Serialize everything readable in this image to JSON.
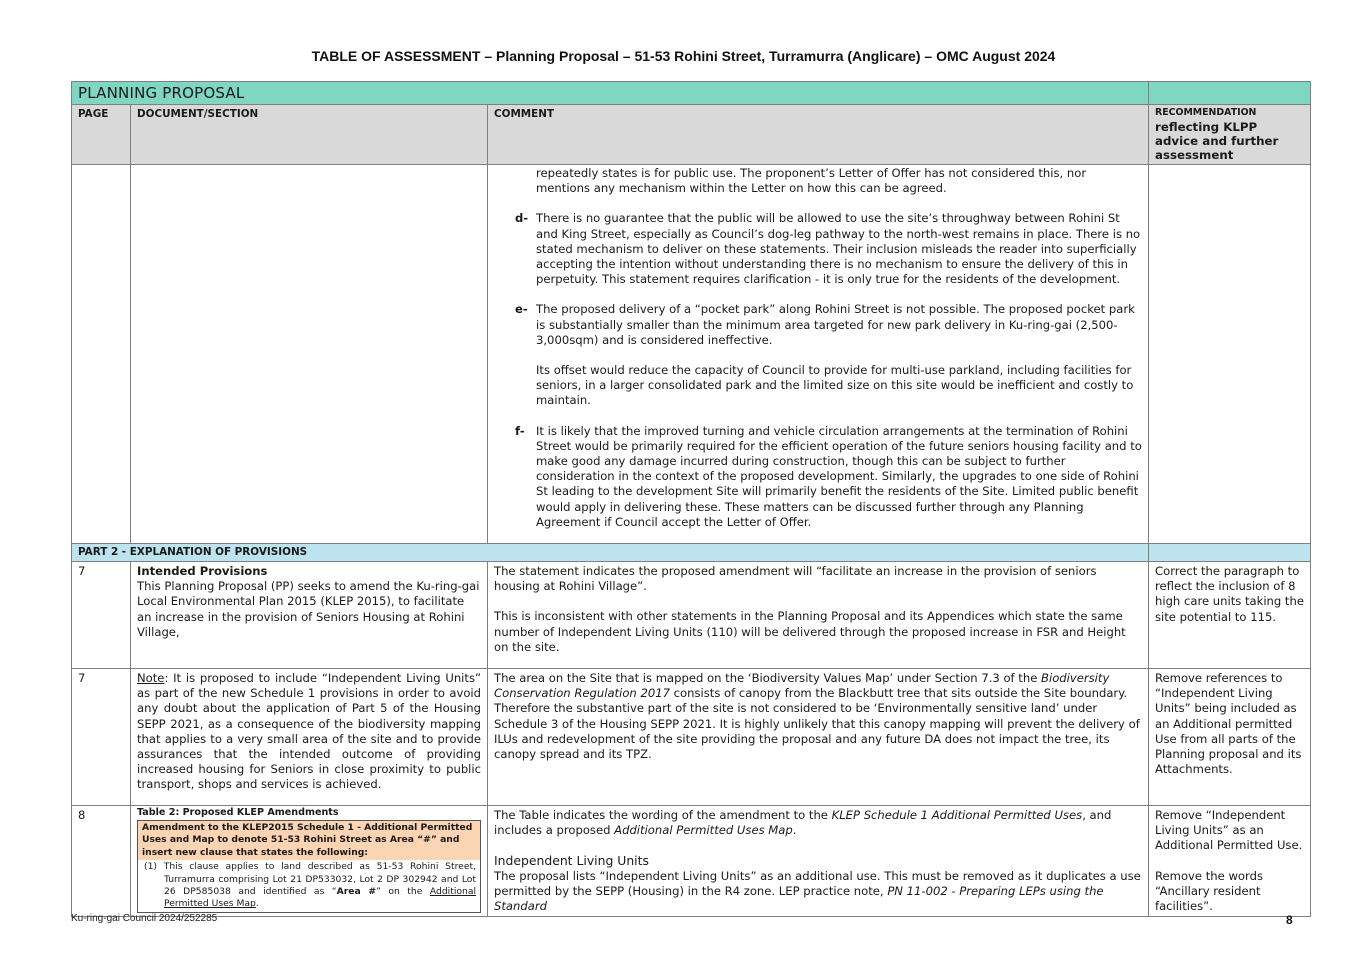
{
  "doc_title": "TABLE OF ASSESSMENT – Planning Proposal – 51-53 Rohini Street, Turramurra (Anglicare) – OMC August 2024",
  "table": {
    "banner": "PLANNING PROPOSAL",
    "headers": {
      "page": "PAGE",
      "document": "DOCUMENT/SECTION",
      "comment": "COMMENT",
      "rec_small": "RECOMMENDATION",
      "rec_big": "reflecting KLPP advice and further assessment"
    },
    "continued_row": {
      "intro": "repeatedly states is for public use. The proponent’s Letter of Offer has not considered this, nor mentions any mechanism within the Letter on how this can be agreed.",
      "items": [
        {
          "marker": "d-",
          "paragraphs": [
            "There is no guarantee that the public will be allowed to use the site’s throughway between Rohini St and King Street, especially as Council’s dog-leg pathway to the north-west remains in place. There is no stated mechanism to deliver on these statements. Their inclusion misleads the reader into superficially accepting the intention without understanding there is no mechanism to ensure the delivery of this in perpetuity. This statement requires clarification - it is only true for the residents of the development."
          ]
        },
        {
          "marker": "e-",
          "paragraphs": [
            "The proposed delivery of a “pocket park” along Rohini Street is not possible. The proposed pocket park is substantially smaller than the minimum area targeted for new park delivery in Ku-ring-gai (2,500-3,000sqm) and is considered ineffective.",
            "Its offset would reduce the capacity of Council to provide for multi-use parkland, including facilities for seniors, in a larger consolidated park and the limited size on this site would be inefficient and costly to maintain."
          ]
        },
        {
          "marker": "f-",
          "paragraphs": [
            "It is likely that the improved turning and vehicle circulation arrangements at the termination of Rohini Street would be primarily required for the efficient operation of the future seniors housing facility and to make good any damage incurred during construction, though this can be subject to further consideration in the context of the proposed development. Similarly, the upgrades to one side of Rohini St leading to the development Site will primarily benefit the residents of the Site. Limited public benefit would apply in delivering these. These matters can be discussed further through any Planning Agreement if Council accept the Letter of Offer."
          ]
        }
      ]
    },
    "part2": "PART 2 - EXPLANATION OF PROVISIONS",
    "row1": {
      "page": "7",
      "doc_heading": "Intended Provisions",
      "doc_text": "This Planning Proposal (PP) seeks to amend the Ku-ring-gai Local Environmental Plan 2015 (KLEP 2015), to facilitate an increase in the provision of Seniors Housing at Rohini Village,",
      "comment_p1": "The statement indicates the proposed amendment will “facilitate an increase in the provision of seniors housing at Rohini Village”.",
      "comment_p2": "This is inconsistent with other statements in the Planning Proposal and its Appendices which state the same number of Independent Living Units (110) will be delivered through the proposed increase in FSR and Height on the site.",
      "rec": "Correct the paragraph to reflect the inclusion of 8 high care units taking the site potential to 115."
    },
    "row2": {
      "page": "7",
      "note_label": "Note",
      "doc_text": ": It is proposed to include “Independent Living Units” as part of the new Schedule 1 provisions in order to avoid any doubt about the application of Part 5 of the Housing SEPP 2021, as a consequence of the biodiversity mapping that applies to a very small area of the site and to provide assurances that the intended outcome of providing increased housing for Seniors in close proximity to public transport, shops and services is achieved.",
      "comment_a": "The area on the Site that is mapped on the ‘Biodiversity Values Map’ under Section 7.3 of the ",
      "comment_italic": "Biodiversity Conservation Regulation 2017",
      "comment_b": " consists of canopy from the Blackbutt tree that sits outside the Site boundary. Therefore the substantive part of the site is not considered to be ‘Environmentally sensitive land’ under  Schedule 3 of the Housing SEPP 2021. It is highly unlikely that this canopy mapping will prevent the delivery of ILUs and redevelopment of the site providing the proposal and any future DA does not impact the tree, its canopy spread and its TPZ.",
      "rec": "Remove references to “Independent Living Units” being included as an Additional permitted Use from all parts of the Planning proposal and its Attachments."
    },
    "row3": {
      "page": "8",
      "klep_title": "Table 2: Proposed KLEP Amendments",
      "klep_head": "Amendment to the KLEP2015 Schedule 1 - Additional Permitted Uses and Map to denote 51-53 Rohini Street as Area “#” and insert new clause that states the following:",
      "klep_clause_a": "(1)  This clause applies to land described as 51-53 Rohini Street, Turramurra comprising Lot 21 DP533032, Lot 2 DP 302942 and Lot 26 DP585038 and identified as “",
      "klep_clause_bold": "Area #",
      "klep_clause_b": "” on the ",
      "klep_clause_link": "Additional Permitted Uses Map",
      "klep_clause_end": ".",
      "comment_a": "The Table indicates the wording of the amendment to the ",
      "comment_italic1": "KLEP Schedule 1 Additional Permitted Uses",
      "comment_b": ", and includes a proposed ",
      "comment_italic2": "Additional Permitted Uses Map",
      "comment_c": ".",
      "ilu_heading": "Independent Living Units",
      "ilu_text_a": "The proposal lists “Independent Living Units” as an additional use. This must be removed as it duplicates a use permitted by the SEPP (Housing) in the R4 zone. LEP practice note, ",
      "ilu_text_italic": "PN 11-002 - Preparing LEPs using the Standard",
      "rec_p1": "Remove “Independent Living Units” as an Additional Permitted Use.",
      "rec_p2": "Remove the words “Ancillary resident facilities”."
    }
  },
  "footer": {
    "left": "Ku-ring-gai Council 2024/252285",
    "page_number": "8"
  }
}
